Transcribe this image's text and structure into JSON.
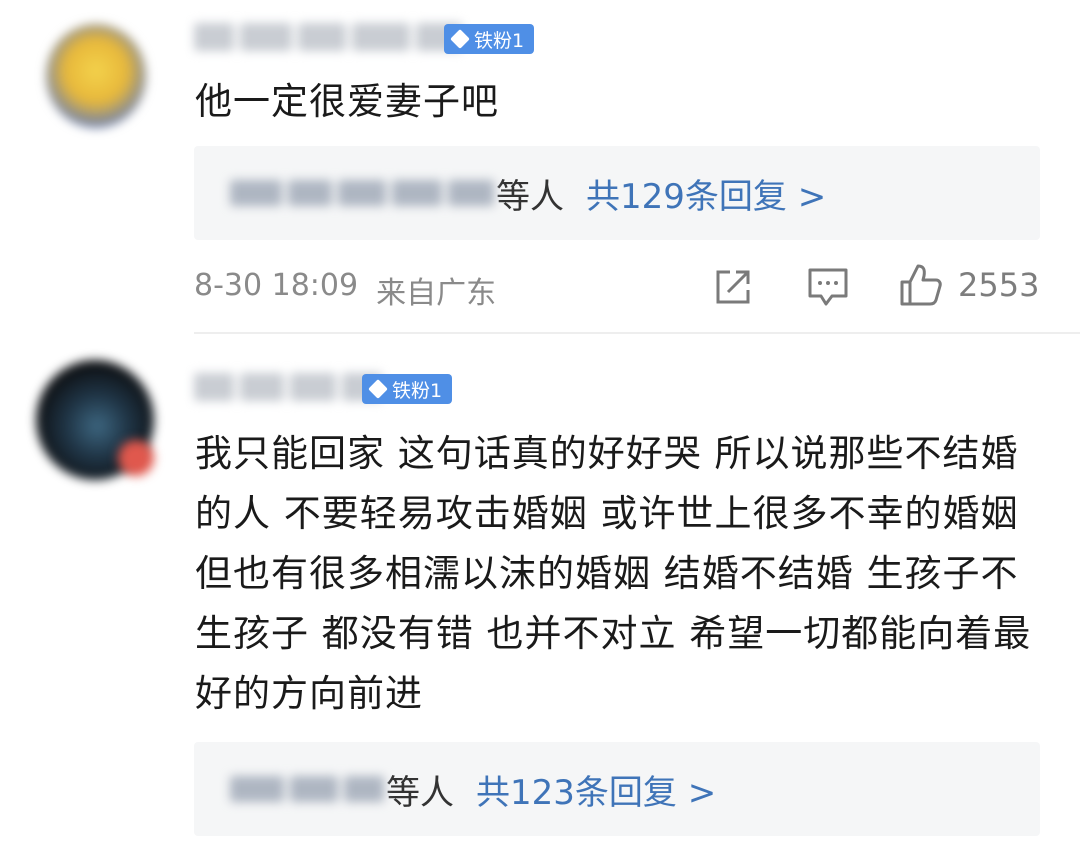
{
  "comments": [
    {
      "badge": "铁粉1",
      "text": "他一定很爱妻子吧",
      "reply_others": "等人",
      "reply_count": "共129条回复 >",
      "timestamp": "8-30 18:09",
      "location": "来自广东",
      "likes": "2553",
      "icons": [
        "share-icon",
        "comment-icon",
        "like-icon"
      ]
    },
    {
      "badge": "铁粉1",
      "text": "我只能回家 这句话真的好好哭 所以说那些不结婚的人 不要轻易攻击婚姻 或许世上很多不幸的婚姻 但也有很多相濡以沫的婚姻 结婚不结婚 生孩子不生孩子 都没有错 也并不对立 希望一切都能向着最好的方向前进",
      "reply_others": "等人",
      "reply_count": "共123条回复 >"
    }
  ],
  "colors": {
    "badge": "#4f8fe6",
    "reply_link": "#3f74b8",
    "reply_bg": "#f5f6f7",
    "meta_text": "#8a8a8a"
  }
}
